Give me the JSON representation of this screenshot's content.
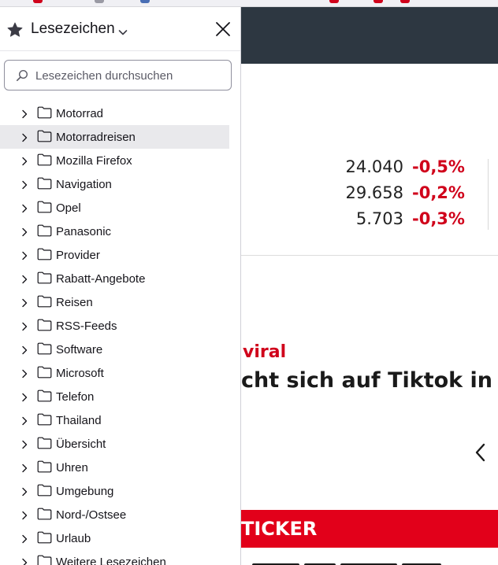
{
  "colors": {
    "page_header_bg": "#2d3741",
    "negative_change": "#d0021b",
    "ticker_bar": "#e2001a",
    "sidebar_selected_bg": "#e9e9ec"
  },
  "sidebar": {
    "title": "Lesezeichen",
    "title_icon": "star-icon",
    "dropdown_icon": "chevron-down-icon",
    "close_icon": "close-icon",
    "search": {
      "placeholder": "Lesezeichen durchsuchen",
      "value": "",
      "icon": "search-icon"
    },
    "folders": [
      {
        "label": "Motorrad",
        "selected": false
      },
      {
        "label": "Motorradreisen",
        "selected": true
      },
      {
        "label": "Mozilla Firefox",
        "selected": false
      },
      {
        "label": "Navigation",
        "selected": false
      },
      {
        "label": "Opel",
        "selected": false
      },
      {
        "label": "Panasonic",
        "selected": false
      },
      {
        "label": "Provider",
        "selected": false
      },
      {
        "label": "Rabatt-Angebote",
        "selected": false
      },
      {
        "label": "Reisen",
        "selected": false
      },
      {
        "label": "RSS-Feeds",
        "selected": false
      },
      {
        "label": "Software",
        "selected": false
      },
      {
        "label": "Microsoft",
        "selected": false
      },
      {
        "label": "Telefon",
        "selected": false
      },
      {
        "label": "Thailand",
        "selected": false
      },
      {
        "label": "Übersicht",
        "selected": false
      },
      {
        "label": "Uhren",
        "selected": false
      },
      {
        "label": "Umgebung",
        "selected": false
      },
      {
        "label": "Nord-/Ostsee",
        "selected": false
      },
      {
        "label": "Urlaub",
        "selected": false
      },
      {
        "label": "Weitere Lesezeichen",
        "selected": false
      }
    ]
  },
  "page": {
    "market": [
      {
        "value": "24.040",
        "change": "-0,5%"
      },
      {
        "value": "29.658",
        "change": "-0,2%"
      },
      {
        "value": "5.703",
        "change": "-0,3%"
      }
    ],
    "article": {
      "kicker": "viral",
      "headline": "cht sich auf Tiktok in die"
    },
    "carousel_prev_icon": "chevron-left-icon",
    "ticker_label": "TICKER"
  }
}
